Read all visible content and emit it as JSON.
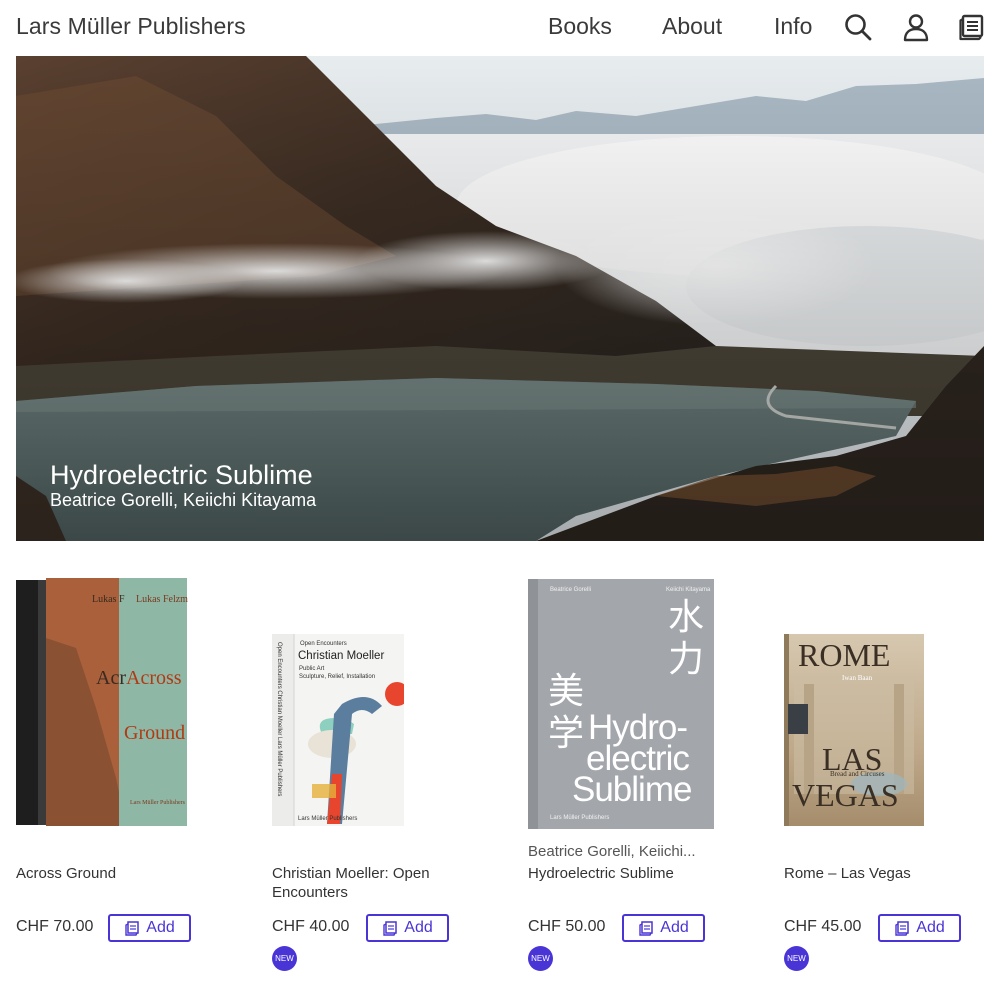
{
  "header": {
    "brand": "Lars Müller Publishers",
    "nav": {
      "books": "Books",
      "about": "About",
      "info": "Info"
    },
    "icons": [
      "search-icon",
      "user-icon",
      "cart-icon"
    ]
  },
  "hero": {
    "title": "Hydroelectric Sublime",
    "subtitle": "Beatrice Gorelli, Keiichi Kitayama"
  },
  "products": [
    {
      "author": "",
      "title": "Across Ground",
      "price": "CHF 70.00",
      "add_label": "Add",
      "badge": "",
      "cover_text": {
        "author": "Lukas Felzmann",
        "line1": "Across",
        "line2": "Ground",
        "publisher": "Lars Müller Publishers",
        "spine_author": "Lukas Felzmann",
        "spine_title": "Across",
        "partial": "Lukas F",
        "partial2": "Acr"
      }
    },
    {
      "author": "",
      "title": "Christian Moeller: Open Encounters",
      "price": "CHF 40.00",
      "add_label": "Add",
      "badge": "NEW",
      "cover_text": {
        "series": "Open Encounters",
        "name": "Christian Moeller",
        "sub1": "Public Art",
        "sub2": "Sculpture, Relief, Installation",
        "publisher": "Lars Müller Publishers",
        "spine": "Open Encounters   Christian Moeller   Lars Müller Publishers"
      }
    },
    {
      "author": "Beatrice Gorelli, Keiichi...",
      "title": "Hydroelectric Sublime",
      "price": "CHF 50.00",
      "add_label": "Add",
      "badge": "NEW",
      "cover_text": {
        "author1": "Beatrice Gorelli",
        "author2": "Keiichi Kitayama",
        "kanji1": "水",
        "kanji2": "力",
        "kanji3": "美",
        "kanji4": "学",
        "line1": "Hydro-",
        "line2": "electric",
        "line3": "Sublime",
        "publisher": "Lars Müller Publishers"
      }
    },
    {
      "author": "",
      "title": "Rome – Las Vegas",
      "price": "CHF 45.00",
      "add_label": "Add",
      "badge": "NEW",
      "cover_text": {
        "line1": "ROME",
        "author": "Iwan Baan",
        "line2": "LAS",
        "sub": "Bread and Circuses",
        "line3": "VEGAS"
      }
    }
  ],
  "colors": {
    "accent": "#4935d6",
    "text": "#333333"
  }
}
